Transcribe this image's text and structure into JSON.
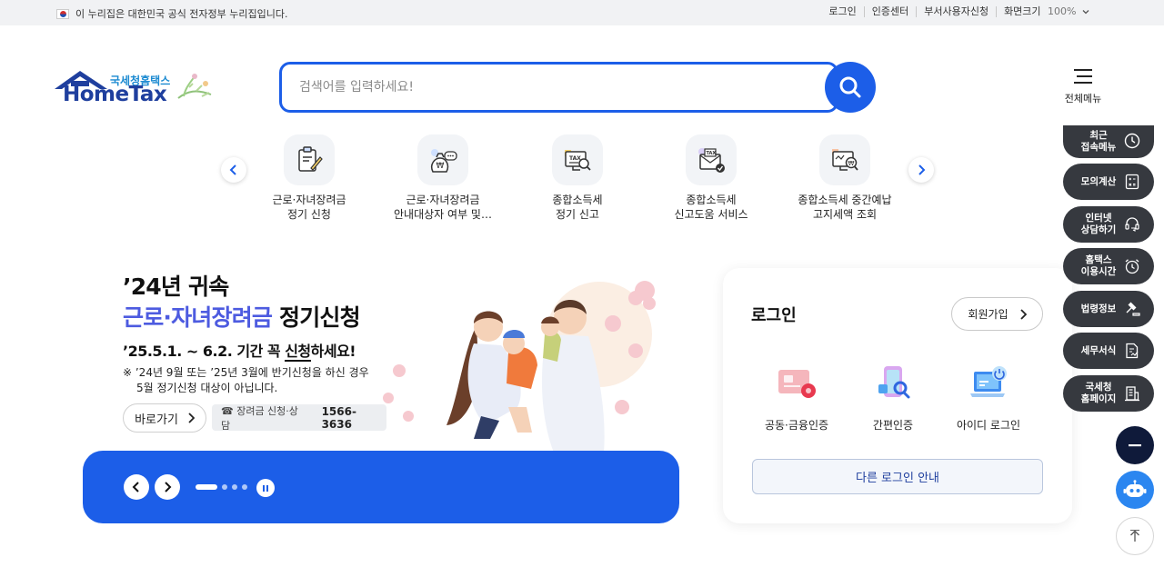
{
  "topbar": {
    "gov_notice": "이 누리집은 대한민국 공식 전자정부 누리집입니다.",
    "links": [
      "로그인",
      "인증센터",
      "부서사용자신청",
      "화면크기"
    ],
    "zoom": "100%"
  },
  "logo": {
    "sub": "국세청홈택스",
    "main": "HomeTax"
  },
  "search": {
    "placeholder": "검색어를 입력하세요!"
  },
  "allmenu": {
    "label": "전체메뉴"
  },
  "quick_menu": [
    {
      "line1": "근로·자녀장려금",
      "line2": "정기 신청",
      "icon": "clipboard-pen-icon"
    },
    {
      "line1": "근로·자녀장려금",
      "line2": "안내대상자 여부 및…",
      "icon": "money-bag-chat-icon"
    },
    {
      "line1": "종합소득세",
      "line2": "정기 신고",
      "icon": "tax-monitor-search-icon"
    },
    {
      "line1": "종합소득세",
      "line2": "신고도움 서비스",
      "icon": "tax-envelope-check-icon"
    },
    {
      "line1": "종합소득세 중간예납",
      "line2": "고지세액 조회",
      "icon": "won-monitor-search-icon"
    }
  ],
  "banner": {
    "line1": "’24년 귀속",
    "line2_highlight": "근로·자녀장려금",
    "line2_rest": " 정기신청",
    "line3_a": "’25.5.1. ~ 6.2. 기간 꼭 ",
    "line3_b": "신청",
    "line3_c": "하세요!",
    "note1": "※ ’24년 9월 또는 ’25년 3월에 반기신청을 하신 경우",
    "note2": "5월 정기신청 대상이 아닙니다.",
    "go_label": "바로가기",
    "phone_label": "☎ 장려금 신청·상담",
    "phone_number": "1566-3636",
    "slides_total": 4,
    "slide_current": 1
  },
  "login": {
    "title": "로그인",
    "join_label": "회원가입",
    "options": [
      "공동·금융인증",
      "간편인증",
      "아이디 로그인"
    ],
    "other_label": "다른 로그인 안내"
  },
  "side_menu": [
    {
      "label": "최근\n접속메뉴",
      "icon": "clock-icon"
    },
    {
      "label": "모의계산",
      "icon": "calculator-icon"
    },
    {
      "label": "인터넷\n상담하기",
      "icon": "headset-chat-icon"
    },
    {
      "label": "홈택스\n이용시간",
      "icon": "alarm-clock-icon"
    },
    {
      "label": "법령정보",
      "icon": "gavel-icon"
    },
    {
      "label": "세무서식",
      "icon": "form-document-icon"
    },
    {
      "label": "국세청\n홈페이지",
      "icon": "building-icon"
    }
  ],
  "colors": {
    "primary": "#1c5ee8",
    "navy": "#1f3f9e",
    "side_bg": "#36393f",
    "highlight": "#4d5be0"
  }
}
